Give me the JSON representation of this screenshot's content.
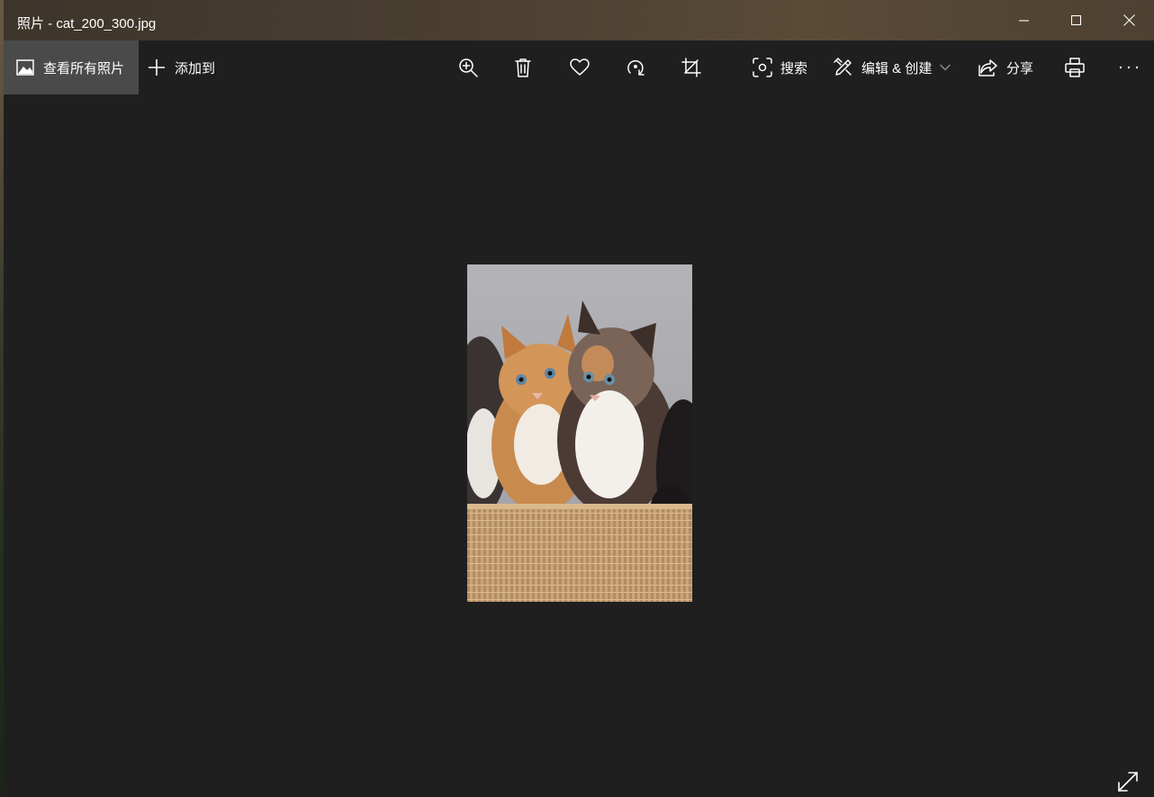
{
  "window": {
    "title": "照片 - cat_200_300.jpg",
    "minimize_icon": "minimize-icon",
    "maximize_icon": "maximize-icon",
    "close_icon": "close-icon"
  },
  "toolbar": {
    "view_all_label": "查看所有照片",
    "add_to_label": "添加到",
    "search_label": "搜索",
    "edit_create_label": "编辑 & 创建",
    "share_label": "分享",
    "icons": [
      "photos-icon",
      "plus-icon",
      "zoom-in-icon",
      "delete-icon",
      "heart-icon",
      "rotate-icon",
      "crop-icon",
      "visual-search-icon",
      "edit-create-icon",
      "chevron-down-icon",
      "share-icon",
      "print-icon",
      "more-icon"
    ]
  },
  "image": {
    "file_name": "cat_200_300.jpg",
    "subject": "kittens-in-basket"
  },
  "colors": {
    "background": "#1f1f1f",
    "selected_button": "#4a4a4a",
    "text": "#ffffff"
  }
}
